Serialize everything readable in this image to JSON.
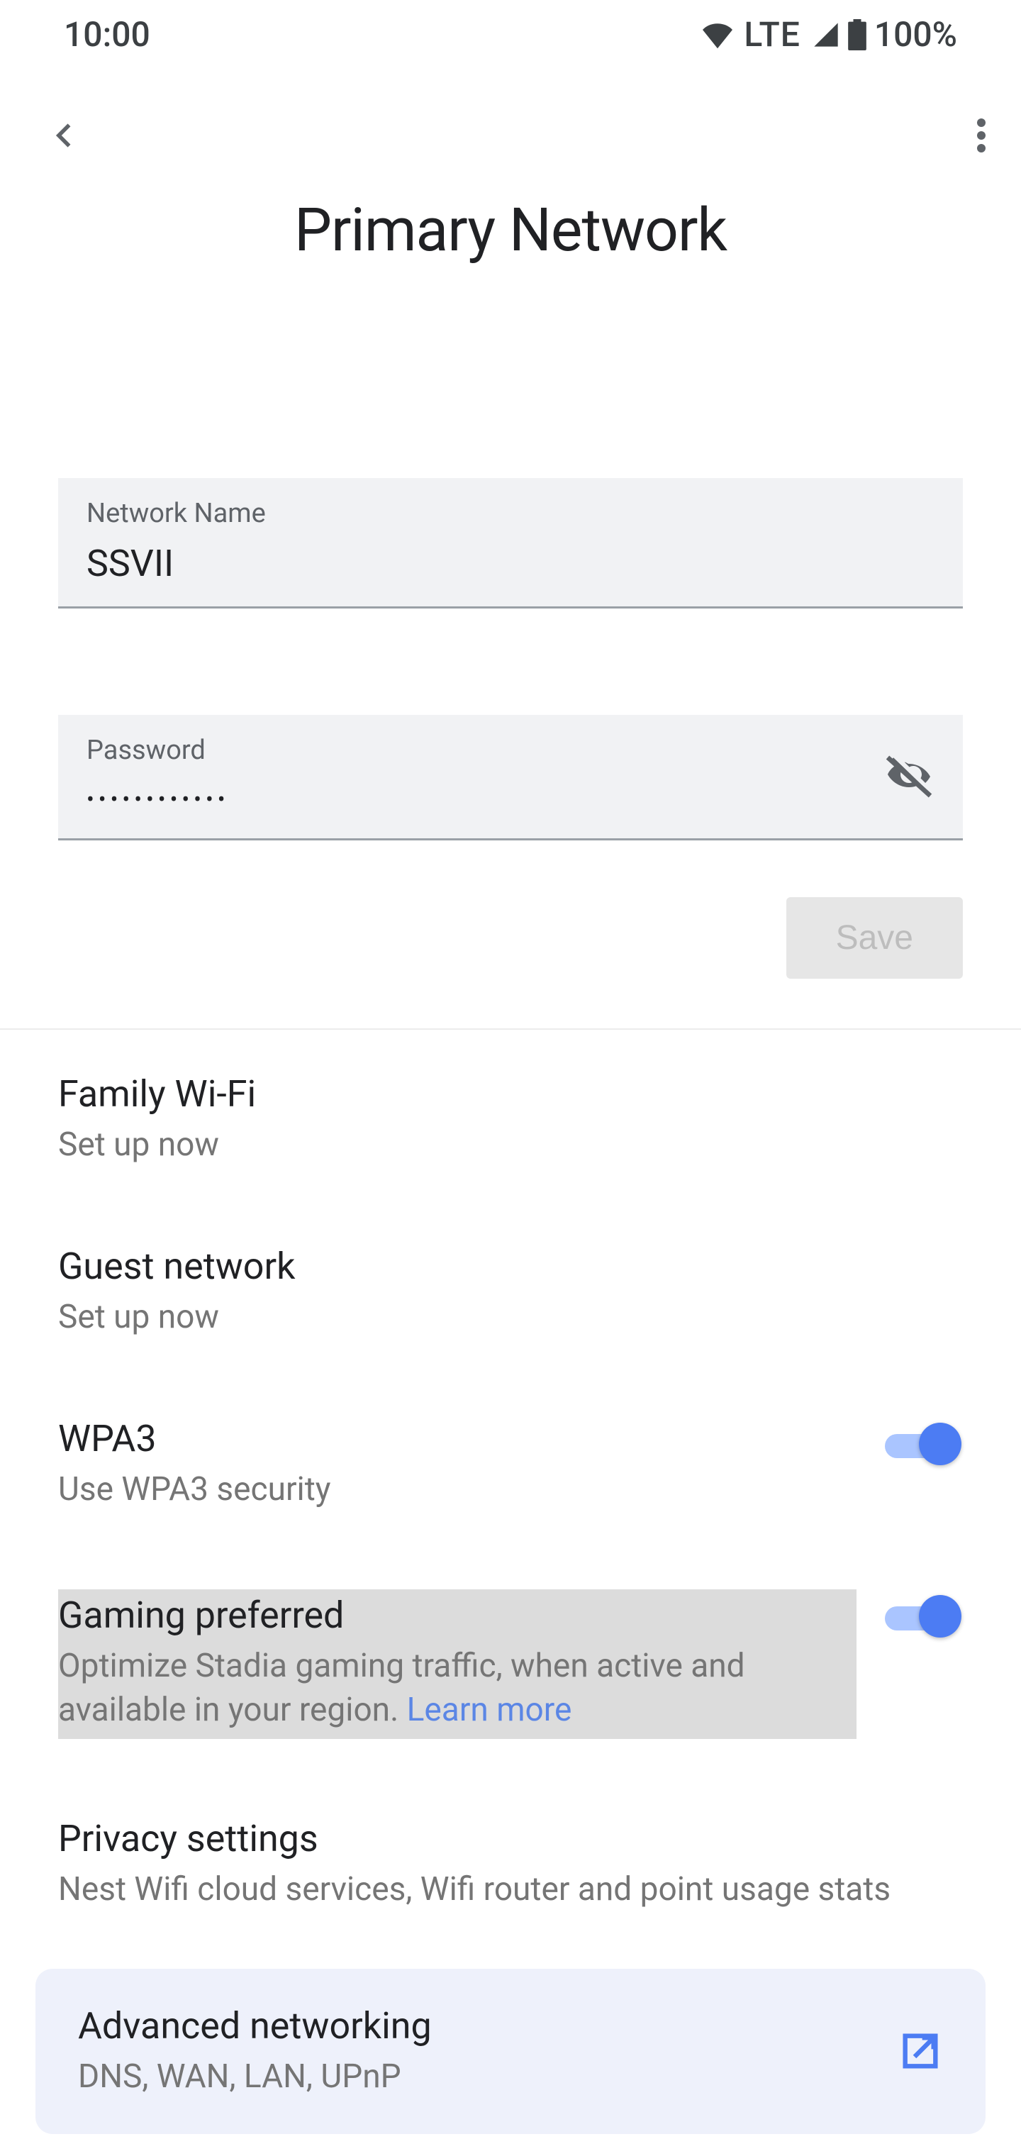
{
  "status": {
    "time": "10:00",
    "network": "LTE",
    "battery": "100%"
  },
  "header": {
    "title": "Primary Network"
  },
  "fields": {
    "name_label": "Network Name",
    "name_value": "SSVII",
    "password_label": "Password",
    "password_masked": "••••••••••••"
  },
  "buttons": {
    "save": "Save"
  },
  "settings": {
    "family": {
      "title": "Family Wi-Fi",
      "sub": "Set up now"
    },
    "guest": {
      "title": "Guest network",
      "sub": "Set up now"
    },
    "wpa3": {
      "title": "WPA3",
      "sub": "Use WPA3 security",
      "on": true
    },
    "gaming": {
      "title": "Gaming preferred",
      "sub": "Optimize Stadia gaming traffic, when active and available in your region. ",
      "learn": "Learn more",
      "on": true
    },
    "privacy": {
      "title": "Privacy settings",
      "sub": "Nest Wifi cloud services, Wifi router and point usage stats"
    },
    "advanced": {
      "title": "Advanced networking",
      "sub": "DNS, WAN, LAN, UPnP"
    }
  }
}
